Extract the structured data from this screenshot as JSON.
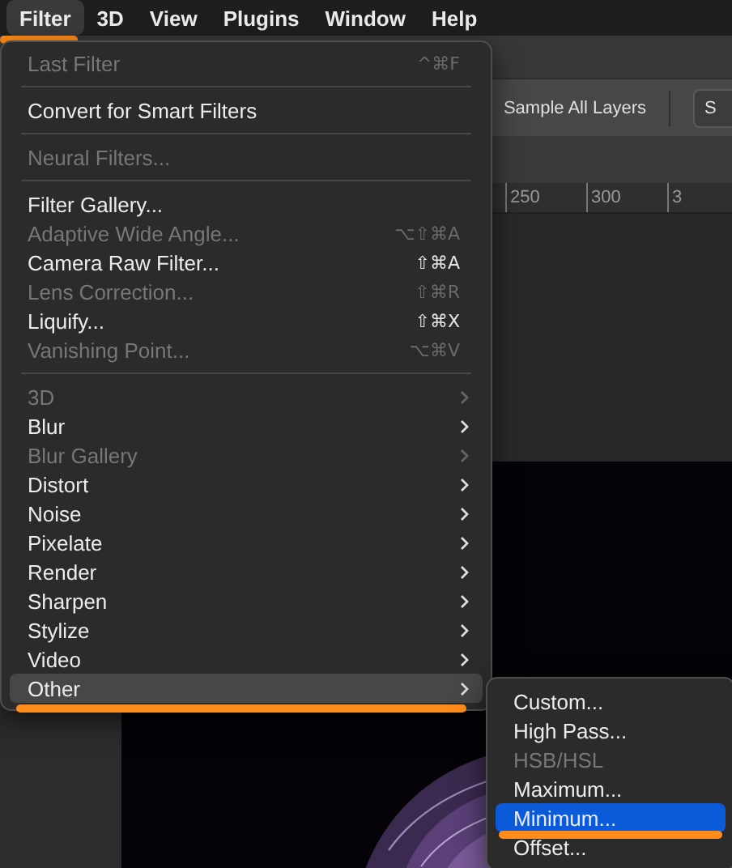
{
  "menubar": [
    {
      "label": "Filter",
      "selected": true,
      "underlined": true
    },
    {
      "label": "3D",
      "selected": false,
      "underlined": false
    },
    {
      "label": "View",
      "selected": false,
      "underlined": false
    },
    {
      "label": "Plugins",
      "selected": false,
      "underlined": false
    },
    {
      "label": "Window",
      "selected": false,
      "underlined": false
    },
    {
      "label": "Help",
      "selected": false,
      "underlined": false
    }
  ],
  "options_bar": {
    "label": "Sample All Layers",
    "button": "S"
  },
  "ruler": [
    "250",
    "300",
    "3"
  ],
  "filter_menu": [
    {
      "kind": "item",
      "label": "Last Filter",
      "disabled": true,
      "shortcut": "^⌘F"
    },
    {
      "kind": "separator"
    },
    {
      "kind": "item",
      "label": "Convert for Smart Filters",
      "disabled": false
    },
    {
      "kind": "separator"
    },
    {
      "kind": "item",
      "label": "Neural Filters...",
      "disabled": true
    },
    {
      "kind": "separator"
    },
    {
      "kind": "item",
      "label": "Filter Gallery...",
      "disabled": false
    },
    {
      "kind": "item",
      "label": "Adaptive Wide Angle...",
      "disabled": true,
      "shortcut": "⌥⇧⌘A"
    },
    {
      "kind": "item",
      "label": "Camera Raw Filter...",
      "disabled": false,
      "shortcut": "⇧⌘A"
    },
    {
      "kind": "item",
      "label": "Lens Correction...",
      "disabled": true,
      "shortcut": "⇧⌘R"
    },
    {
      "kind": "item",
      "label": "Liquify...",
      "disabled": false,
      "shortcut": "⇧⌘X"
    },
    {
      "kind": "item",
      "label": "Vanishing Point...",
      "disabled": true,
      "shortcut": "⌥⌘V"
    },
    {
      "kind": "separator"
    },
    {
      "kind": "submenu",
      "label": "3D",
      "disabled": true,
      "selected": false,
      "underlined": false
    },
    {
      "kind": "submenu",
      "label": "Blur",
      "disabled": false,
      "selected": false,
      "underlined": false
    },
    {
      "kind": "submenu",
      "label": "Blur Gallery",
      "disabled": true,
      "selected": false,
      "underlined": false
    },
    {
      "kind": "submenu",
      "label": "Distort",
      "disabled": false,
      "selected": false,
      "underlined": false
    },
    {
      "kind": "submenu",
      "label": "Noise",
      "disabled": false,
      "selected": false,
      "underlined": false
    },
    {
      "kind": "submenu",
      "label": "Pixelate",
      "disabled": false,
      "selected": false,
      "underlined": false
    },
    {
      "kind": "submenu",
      "label": "Render",
      "disabled": false,
      "selected": false,
      "underlined": false
    },
    {
      "kind": "submenu",
      "label": "Sharpen",
      "disabled": false,
      "selected": false,
      "underlined": false
    },
    {
      "kind": "submenu",
      "label": "Stylize",
      "disabled": false,
      "selected": false,
      "underlined": false
    },
    {
      "kind": "submenu",
      "label": "Video",
      "disabled": false,
      "selected": false,
      "underlined": false
    },
    {
      "kind": "submenu",
      "label": "Other",
      "disabled": false,
      "selected": true,
      "underlined": true
    }
  ],
  "other_submenu": [
    {
      "label": "Custom...",
      "disabled": false,
      "selected": false,
      "underlined": false
    },
    {
      "label": "High Pass...",
      "disabled": false,
      "selected": false,
      "underlined": false
    },
    {
      "label": "HSB/HSL",
      "disabled": true,
      "selected": false,
      "underlined": false
    },
    {
      "label": "Maximum...",
      "disabled": false,
      "selected": false,
      "underlined": false
    },
    {
      "label": "Minimum...",
      "disabled": false,
      "selected": true,
      "underlined": true
    },
    {
      "label": "Offset...",
      "disabled": false,
      "selected": false,
      "underlined": false
    }
  ]
}
